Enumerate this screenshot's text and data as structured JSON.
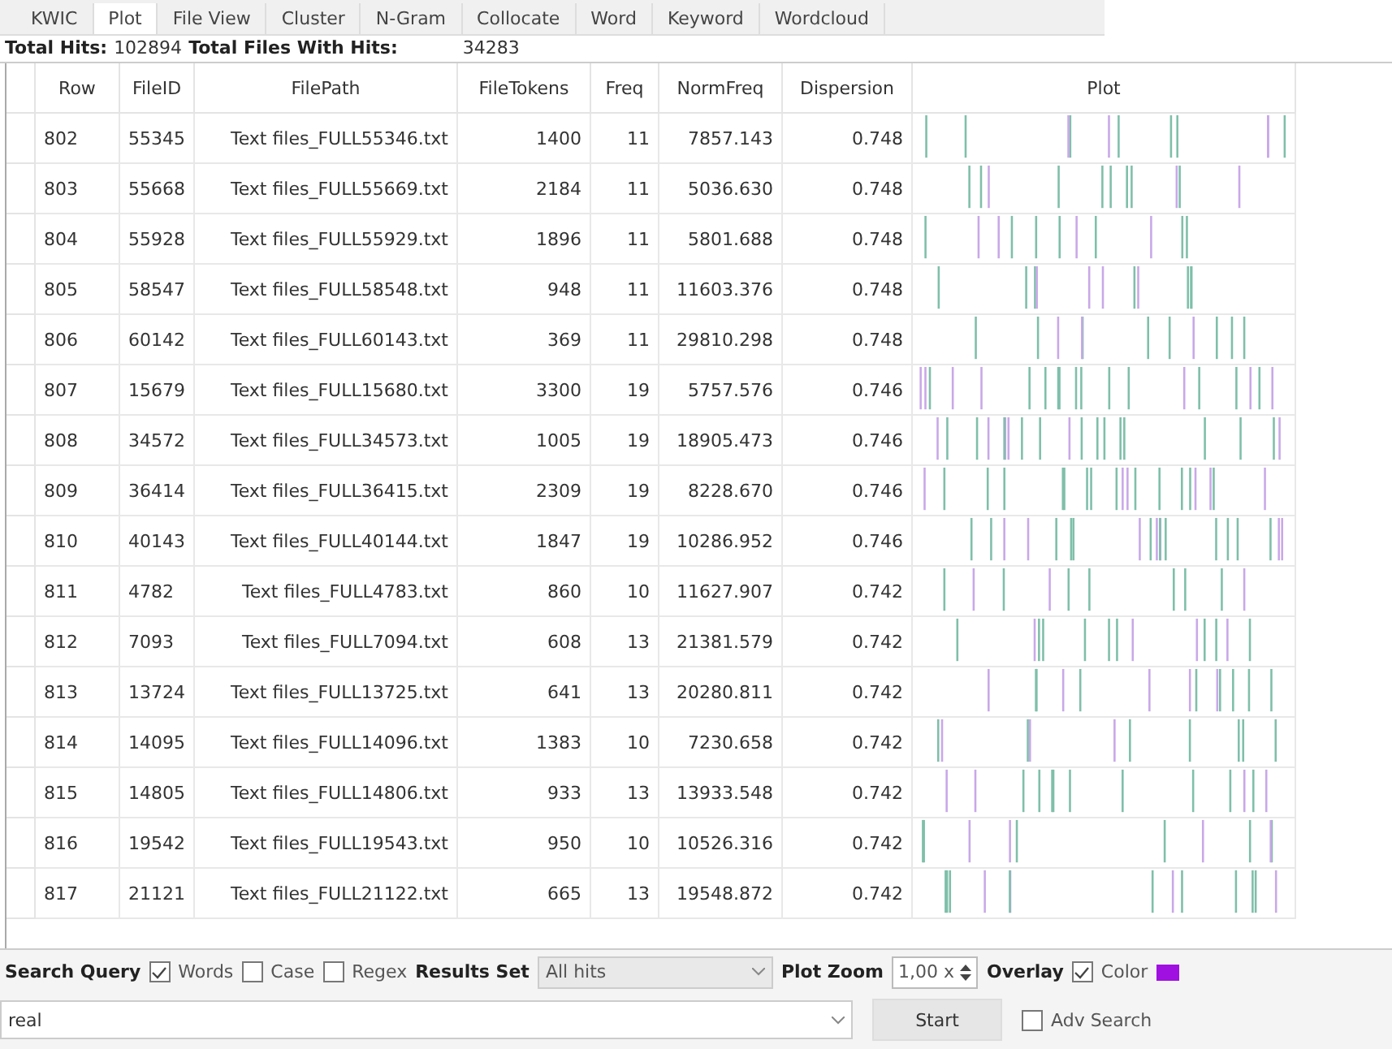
{
  "tabs": [
    {
      "label": "KWIC",
      "selected": false
    },
    {
      "label": "Plot",
      "selected": true
    },
    {
      "label": "File View",
      "selected": false
    },
    {
      "label": "Cluster",
      "selected": false
    },
    {
      "label": "N-Gram",
      "selected": false
    },
    {
      "label": "Collocate",
      "selected": false
    },
    {
      "label": "Word",
      "selected": false
    },
    {
      "label": "Keyword",
      "selected": false
    },
    {
      "label": "Wordcloud",
      "selected": false
    }
  ],
  "totals": {
    "hits_label": "Total Hits:",
    "hits": "102894",
    "files_label": "Total Files With Hits:",
    "files": "34283"
  },
  "table": {
    "columns": [
      "Row",
      "FileID",
      "FilePath",
      "FileTokens",
      "Freq",
      "NormFreq",
      "Dispersion",
      "Plot"
    ],
    "rows": [
      [
        "802",
        "55345",
        "Text files_FULL55346.txt",
        "1400",
        "11",
        "7857.143",
        "0.748"
      ],
      [
        "803",
        "55668",
        "Text files_FULL55669.txt",
        "2184",
        "11",
        "5036.630",
        "0.748"
      ],
      [
        "804",
        "55928",
        "Text files_FULL55929.txt",
        "1896",
        "11",
        "5801.688",
        "0.748"
      ],
      [
        "805",
        "58547",
        "Text files_FULL58548.txt",
        "948",
        "11",
        "11603.376",
        "0.748"
      ],
      [
        "806",
        "60142",
        "Text files_FULL60143.txt",
        "369",
        "11",
        "29810.298",
        "0.748"
      ],
      [
        "807",
        "15679",
        "Text files_FULL15680.txt",
        "3300",
        "19",
        "5757.576",
        "0.746"
      ],
      [
        "808",
        "34572",
        "Text files_FULL34573.txt",
        "1005",
        "19",
        "18905.473",
        "0.746"
      ],
      [
        "809",
        "36414",
        "Text files_FULL36415.txt",
        "2309",
        "19",
        "8228.670",
        "0.746"
      ],
      [
        "810",
        "40143",
        "Text files_FULL40144.txt",
        "1847",
        "19",
        "10286.952",
        "0.746"
      ],
      [
        "811",
        "4782",
        "Text files_FULL4783.txt",
        "860",
        "10",
        "11627.907",
        "0.742"
      ],
      [
        "812",
        "7093",
        "Text files_FULL7094.txt",
        "608",
        "13",
        "21381.579",
        "0.742"
      ],
      [
        "813",
        "13724",
        "Text files_FULL13725.txt",
        "641",
        "13",
        "20280.811",
        "0.742"
      ],
      [
        "814",
        "14095",
        "Text files_FULL14096.txt",
        "1383",
        "10",
        "7230.658",
        "0.742"
      ],
      [
        "815",
        "14805",
        "Text files_FULL14806.txt",
        "933",
        "13",
        "13933.548",
        "0.742"
      ],
      [
        "816",
        "19542",
        "Text files_FULL19543.txt",
        "950",
        "10",
        "10526.316",
        "0.742"
      ],
      [
        "817",
        "21121",
        "Text files_FULL21122.txt",
        "665",
        "13",
        "19548.872",
        "0.742"
      ]
    ]
  },
  "controls": {
    "search_label": "Search Query",
    "words": {
      "label": "Words",
      "checked": true
    },
    "case": {
      "label": "Case",
      "checked": false
    },
    "regex": {
      "label": "Regex",
      "checked": false
    },
    "results_label": "Results Set",
    "results_value": "All hits",
    "zoom_label": "Plot Zoom",
    "zoom_value": "1,00 x",
    "overlay_label": "Overlay",
    "color": {
      "label": "Color",
      "checked": true,
      "color": "#a010e0"
    }
  },
  "query": {
    "value": "real"
  },
  "start_button": "Start",
  "adv_search": {
    "label": "Adv Search",
    "checked": false
  }
}
